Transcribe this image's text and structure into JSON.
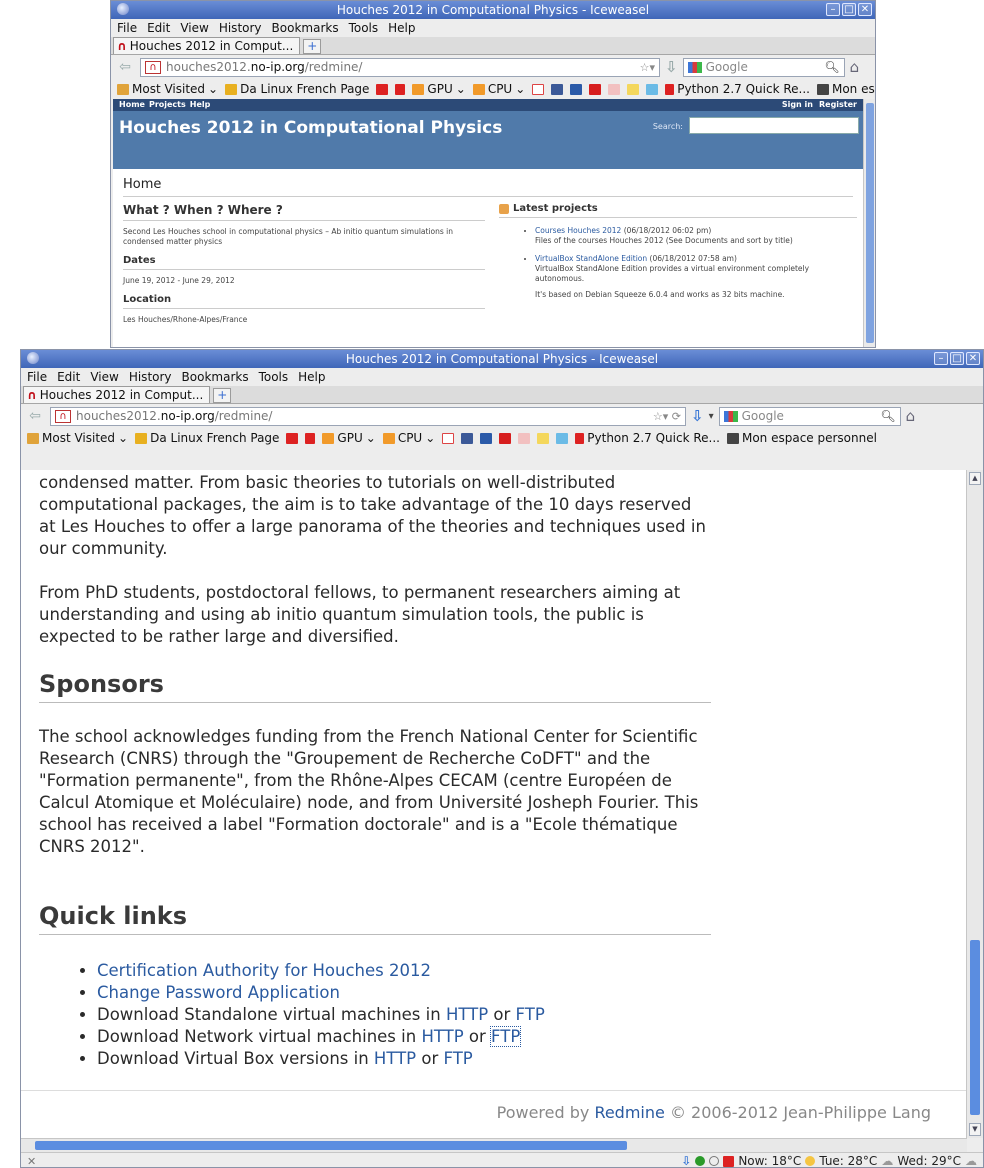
{
  "back_window": {
    "title": "Houches 2012 in Computational Physics - Iceweasel",
    "menu": [
      "File",
      "Edit",
      "View",
      "History",
      "Bookmarks",
      "Tools",
      "Help"
    ],
    "tab_label": "Houches 2012 in Comput...",
    "url": {
      "part1": "houches2012.",
      "part2": "no-ip.org",
      "part3": "/redmine/"
    },
    "search_placeholder": "Google",
    "bookmarks": [
      {
        "label": "Most Visited",
        "icon": "folder-icon"
      },
      {
        "label": "Da Linux French Page",
        "icon": "snake-icon"
      },
      {
        "label": "",
        "icon": "red-icon"
      },
      {
        "label": "",
        "icon": "it-icon"
      },
      {
        "label": "GPU",
        "icon": "rss-icon"
      },
      {
        "label": "CPU",
        "icon": "rss-icon"
      },
      {
        "label": "",
        "icon": "gmail-icon"
      },
      {
        "label": "",
        "icon": "facebook-icon"
      },
      {
        "label": "",
        "icon": "blue-icon"
      },
      {
        "label": "",
        "icon": "youtube-icon"
      },
      {
        "label": "",
        "icon": "cl-icon"
      },
      {
        "label": "",
        "icon": "music-icon"
      },
      {
        "label": "",
        "icon": "cyan-icon"
      },
      {
        "label": "Python 2.7 Quick Re...",
        "icon": "python-icon"
      },
      {
        "label": "Mon espace personnel",
        "icon": "dark-icon"
      }
    ],
    "redmine": {
      "top_left": [
        "Home",
        "Projects",
        "Help"
      ],
      "top_right": [
        "Sign in",
        "Register"
      ],
      "project_title": "Houches 2012 in Computational Physics",
      "search_label": "Search:",
      "page_heading": "Home",
      "what_heading": "What ? When ? Where ?",
      "what_text": "Second Les Houches school in computational physics – Ab initio quantum simulations in condensed matter physics",
      "dates_heading": "Dates",
      "dates_text": "June 19, 2012 - June 29, 2012",
      "location_heading": "Location",
      "location_text": "Les Houches/Rhone-Alpes/France",
      "latest_heading": "Latest projects",
      "projects": [
        {
          "name": "Courses Houches 2012",
          "date": " (06/18/2012 06:02 pm)",
          "desc": "Files of the courses Houches 2012 (See Documents and sort by title)"
        },
        {
          "name": "VirtualBox StandAlone Edition",
          "date": " (06/18/2012 07:58 am)",
          "desc": "VirtualBox StandAlone Edition provides a virtual environment completely autonomous."
        }
      ],
      "extra_text": "It's based on Debian Squeeze 6.0.4 and works as 32 bits machine."
    }
  },
  "front_window": {
    "title": "Houches 2012 in Computational Physics - Iceweasel",
    "menu": [
      "File",
      "Edit",
      "View",
      "History",
      "Bookmarks",
      "Tools",
      "Help"
    ],
    "tab_label": "Houches 2012 in Comput...",
    "url": {
      "part1": "houches2012.",
      "part2": "no-ip.org",
      "part3": "/redmine/"
    },
    "search_placeholder": "Google",
    "content": {
      "para1": "condensed matter. From basic theories to tutorials on well-distributed computational packages, the aim is to take advantage of the 10 days reserved at Les Houches to offer a large panorama of the theories and techniques used in our community.",
      "para2": "From PhD students, postdoctoral fellows, to permanent researchers aiming at understanding and using ab initio quantum simulation tools, the public is expected to be rather large and diversified.",
      "sponsors_heading": "Sponsors",
      "sponsors_text": "The school acknowledges funding from the French National Center for Scientific Research (CNRS) through the \"Groupement de Recherche CoDFT\" and the \"Formation permanente\", from the Rhône-Alpes CECAM (centre Européen de Calcul Atomique et Moléculaire) node, and from Université Josheph Fourier. This school has received a label \"Formation doctorale\" and is a \"Ecole thématique CNRS 2012\".",
      "quicklinks_heading": "Quick links",
      "quicklinks": {
        "cert": "Certification Authority for Houches 2012",
        "pwd": "Change Password Application",
        "standalone_prefix": "Download Standalone virtual machines in ",
        "network_prefix": "Download Network virtual machines in ",
        "vbox_prefix": "Download Virtual Box versions in ",
        "http": "HTTP",
        "or": " or ",
        "ftp": "FTP"
      },
      "footer_prefix": "Powered by ",
      "footer_link": "Redmine",
      "footer_suffix": " © 2006-2012 Jean-Philippe Lang"
    },
    "status": {
      "close_glyph": "✕",
      "weather": "Now: 18°C",
      "tue": "Tue: 28°C",
      "wed": "Wed: 29°C"
    }
  }
}
